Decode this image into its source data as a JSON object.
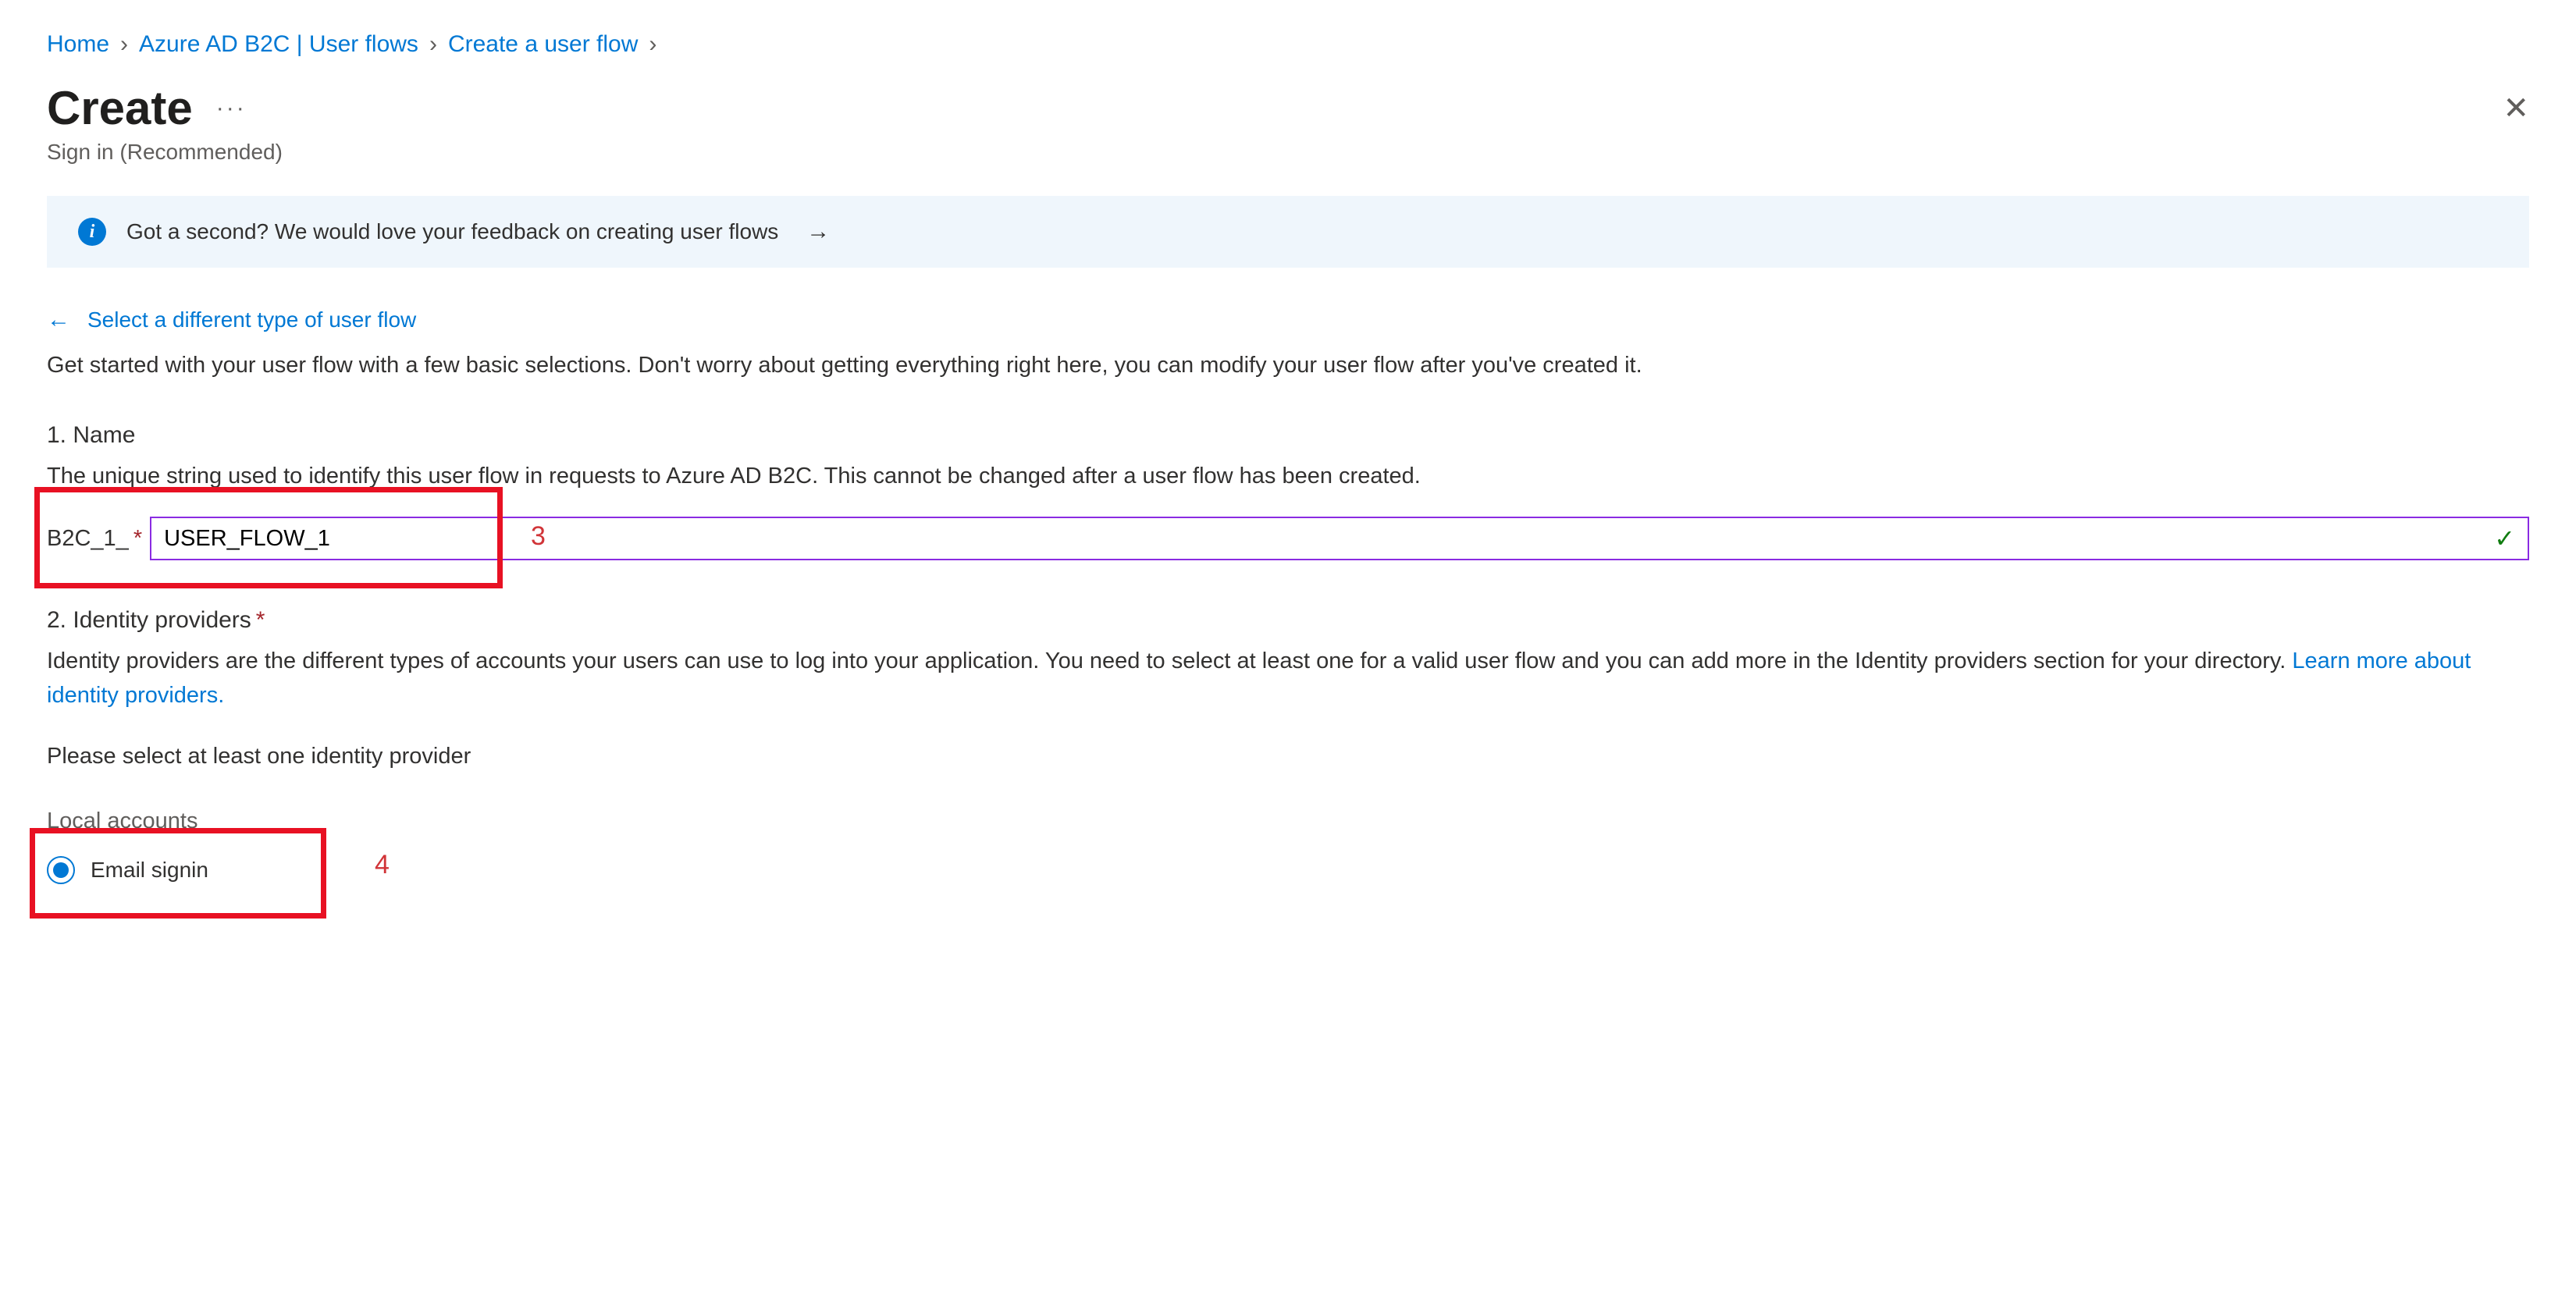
{
  "breadcrumb": {
    "home": "Home",
    "userflows": "Azure AD B2C | User flows",
    "create": "Create a user flow"
  },
  "heading": {
    "title": "Create",
    "subtitle": "Sign in (Recommended)"
  },
  "feedback": {
    "text": "Got a second? We would love your feedback on creating user flows"
  },
  "backlink": {
    "text": "Select a different type of user flow"
  },
  "intro": "Get started with your user flow with a few basic selections. Don't worry about getting everything right here, you can modify your user flow after you've created it.",
  "section_name": {
    "title": "1. Name",
    "desc": "The unique string used to identify this user flow in requests to Azure AD B2C. This cannot be changed after a user flow has been created.",
    "prefix": "B2C_1_",
    "value": "USER_FLOW_1"
  },
  "section_idp": {
    "title": "2. Identity providers",
    "desc_pre": "Identity providers are the different types of accounts your users can use to log into your application. You need to select at least one for a valid user flow and you can add more in the Identity providers section for your directory. ",
    "learn_more": "Learn more about identity providers.",
    "instruction": "Please select at least one identity provider",
    "local_label": "Local accounts",
    "option_email": "Email signin"
  },
  "annotations": {
    "num3": "3",
    "num4": "4"
  }
}
